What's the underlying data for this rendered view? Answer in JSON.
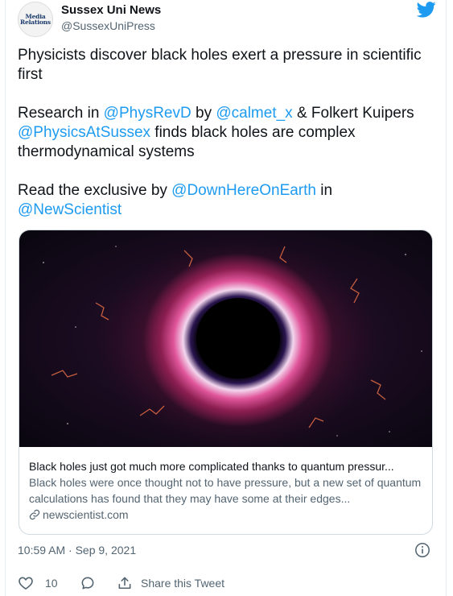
{
  "account": {
    "display_name": "Sussex Uni News",
    "handle": "@SussexUniPress",
    "avatar_text": [
      "Media",
      "Relations"
    ]
  },
  "tweet": {
    "line1": "Physicists discover black holes exert a pressure in scientific first",
    "p2_text1": "Research in ",
    "p2_mention1": "@PhysRevD",
    "p2_text2": " by ",
    "p2_mention2": "@calmet_x",
    "p2_text3": " & Folkert Kuipers ",
    "p2_mention3": "@PhysicsAtSussex",
    "p2_text4": " finds black holes are complex thermodynamical systems",
    "p3_text1": "Read the exclusive by ",
    "p3_mention1": "@DownHereOnEarth",
    "p3_text2": " in ",
    "p3_mention2": "@NewScientist"
  },
  "card": {
    "title": "Black holes just got much more complicated thanks to quantum pressur...",
    "description": "Black holes were once thought not to have pressure, but a new set of quantum calculations has found that they may have some at their edges...",
    "domain": "newscientist.com"
  },
  "meta": {
    "timestamp": "10:59 AM · Sep 9, 2021"
  },
  "actions": {
    "like_count": "10",
    "share_label": "Share this Tweet"
  },
  "colors": {
    "link": "#1d9bf0",
    "secondary_text": "#536471",
    "border": "#cfd9de"
  },
  "icons": {
    "brand": "twitter-bird-icon",
    "link": "link-icon",
    "info": "info-icon",
    "like": "heart-icon",
    "reply": "reply-bubble-icon",
    "share": "share-icon"
  }
}
